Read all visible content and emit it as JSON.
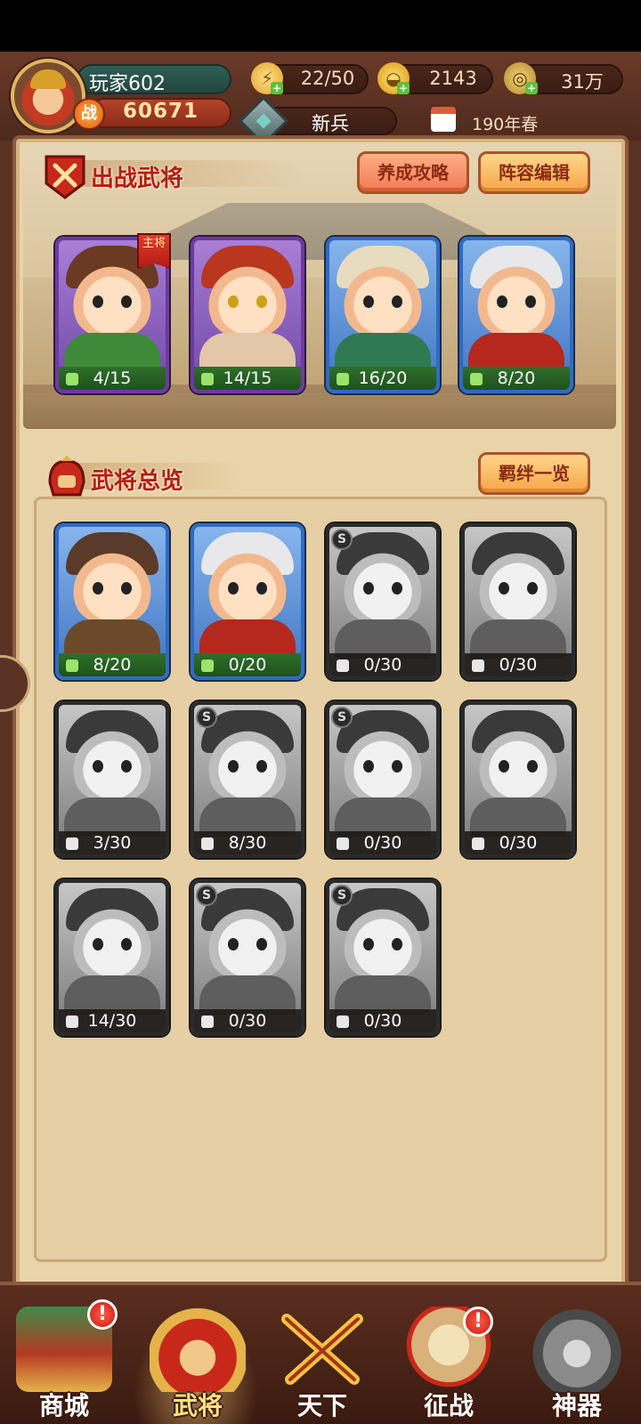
{
  "player": {
    "name": "玩家602",
    "power_badge": "战",
    "power": "60671",
    "rank": "新兵",
    "date": "190年春"
  },
  "resources": {
    "stamina": "22/50",
    "gold": "2143",
    "coins": "31万"
  },
  "battle_section": {
    "title": "出战武将",
    "guide_button": "养成攻略",
    "formation_button": "阵容编辑",
    "main_tag": "主将",
    "generals": [
      {
        "count": "4/15",
        "rarity": "purple"
      },
      {
        "count": "14/15",
        "rarity": "purple"
      },
      {
        "count": "16/20",
        "rarity": "blue"
      },
      {
        "count": "8/20",
        "rarity": "blue"
      }
    ]
  },
  "overview_section": {
    "title": "武将总览",
    "bonds_button": "羁绊一览",
    "s_badge": "S",
    "generals": [
      {
        "count": "8/20",
        "rarity": "blue"
      },
      {
        "count": "0/20",
        "rarity": "blue"
      },
      {
        "count": "0/30",
        "rarity": "gray"
      },
      {
        "count": "0/30",
        "rarity": "gray"
      },
      {
        "count": "3/30",
        "rarity": "gray"
      },
      {
        "count": "8/30",
        "rarity": "gray"
      },
      {
        "count": "0/30",
        "rarity": "gray"
      },
      {
        "count": "0/30",
        "rarity": "gray"
      },
      {
        "count": "14/30",
        "rarity": "gray"
      },
      {
        "count": "0/30",
        "rarity": "gray"
      },
      {
        "count": "0/30",
        "rarity": "gray"
      }
    ]
  },
  "nav": {
    "alert": "!",
    "items": [
      {
        "label": "商城"
      },
      {
        "label": "武将"
      },
      {
        "label": "天下"
      },
      {
        "label": "征战"
      },
      {
        "label": "神器"
      }
    ]
  },
  "colors": {
    "accent_red": "#b51d12",
    "parchment": "#e9d3a9",
    "purple_frame": "#6d3aa0",
    "blue_frame": "#2f6bc2",
    "count_green": "#2e6f2a"
  }
}
